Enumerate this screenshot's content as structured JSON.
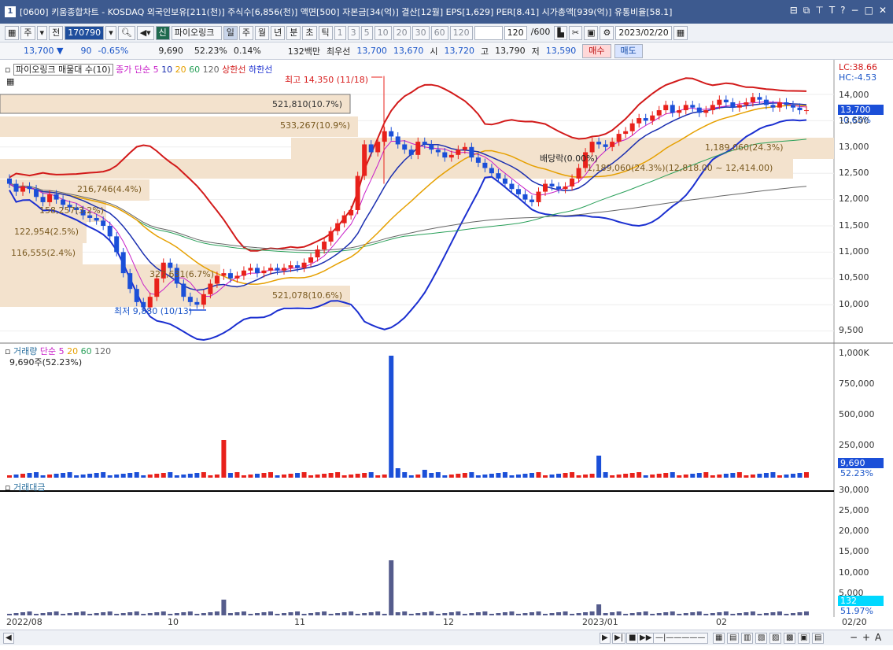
{
  "window": {
    "title": "[0600] 키움종합차트 - KOSDAQ 외국인보유[211(천)] 주식수[6,856(천)] 액면[500] 자본금[34(억)] 결산[12월] EPS[1,629] PER[8.41] 시가총액[939(억)] 유통비율[58.1]",
    "app_number": "1"
  },
  "toolbar": {
    "period": "주",
    "code_prefix": "전",
    "code": "170790",
    "brand": "파이오링크",
    "timeframes": [
      "일",
      "주",
      "월",
      "년",
      "분",
      "초",
      "틱"
    ],
    "selected_timeframe": "일",
    "intervals": [
      "1",
      "3",
      "5",
      "10",
      "20",
      "30",
      "60",
      "120"
    ],
    "count": "120",
    "count_total": "/600",
    "date": "2023/02/20",
    "sin": "신"
  },
  "infobar": {
    "price": "13,700",
    "arrow": "▼",
    "change": "90",
    "change_pct": "-0.65%",
    "volume": "9,690",
    "vol_pct": "52.23%",
    "turnover": "0.14%",
    "amount": "132백만",
    "best_label": "최우선",
    "best_ask": "13,700",
    "best_bid": "13,670",
    "open_label": "시",
    "open": "13,720",
    "high_label": "고",
    "high": "13,790",
    "low_label": "저",
    "low": "13,590",
    "buy_label": "매수",
    "sell_label": "매도"
  },
  "price_panel": {
    "legend_name": "파이오링크 매물대 수(10)",
    "legend_ma_label": "종가 단순",
    "legend_ma": [
      "5",
      "10",
      "20",
      "60",
      "120"
    ],
    "legend_band": "상한선",
    "legend_band2": "하한선",
    "lc": "LC:38.66",
    "hc": "HC:-4.53",
    "y_ticks": [
      "14,000",
      "13,500",
      "13,000",
      "12,500",
      "12,000",
      "11,500",
      "11,000",
      "10,500",
      "10,000",
      "9,500"
    ],
    "current_price_tag": "13,700",
    "current_pct_tag": "-0.65%",
    "high_note": "최고 14,350 (11/18)",
    "low_note": "최저 9,880 (10/13)",
    "dividend_note": "배당락(0.00%)",
    "volume_profile": [
      {
        "label": "521,810(10.7%)"
      },
      {
        "label": "533,267(10.9%)"
      },
      {
        "label": "1,189,060(24.3%)"
      },
      {
        "label": "1,189,060(24.3%)(12,818.00 ~ 12,414.00)"
      },
      {
        "label": "216,746(4.4%)"
      },
      {
        "label": "158,257(3.2%)"
      },
      {
        "label": "122,954(2.5%)"
      },
      {
        "label": "116,555(2.4%)"
      },
      {
        "label": "327,631(6.7%)"
      },
      {
        "label": "521,078(10.6%)"
      }
    ]
  },
  "volume_panel": {
    "legend_name": "거래량",
    "legend_ma_label": "단순",
    "legend_ma": [
      "5",
      "20",
      "60",
      "120"
    ],
    "current_note": "9,690주(52.23%)",
    "y_ticks": [
      "1,000K",
      "750,000",
      "500,000",
      "250,000"
    ],
    "tag_value": "9,690",
    "tag_pct": "52.23%"
  },
  "amount_panel": {
    "legend_name": "거래대금",
    "y_ticks": [
      "30,000",
      "25,000",
      "20,000",
      "15,000",
      "10,000",
      "5,000"
    ],
    "tag_value": "132",
    "tag_pct": "51.97%"
  },
  "x_axis": {
    "labels": [
      "2022/08",
      "10",
      "11",
      "12",
      "2023/01",
      "02",
      "02/20"
    ]
  },
  "colors": {
    "rise": "#e8211b",
    "fall": "#1b4fd8",
    "ma5": "#c81ec8",
    "ma10": "#1b2fb0",
    "ma20": "#e6a000",
    "ma60": "#2aa05a",
    "ma120": "#666666",
    "upper": "#d21a1a",
    "lower": "#1b2fd0",
    "profile": "#f3e2cd"
  }
}
